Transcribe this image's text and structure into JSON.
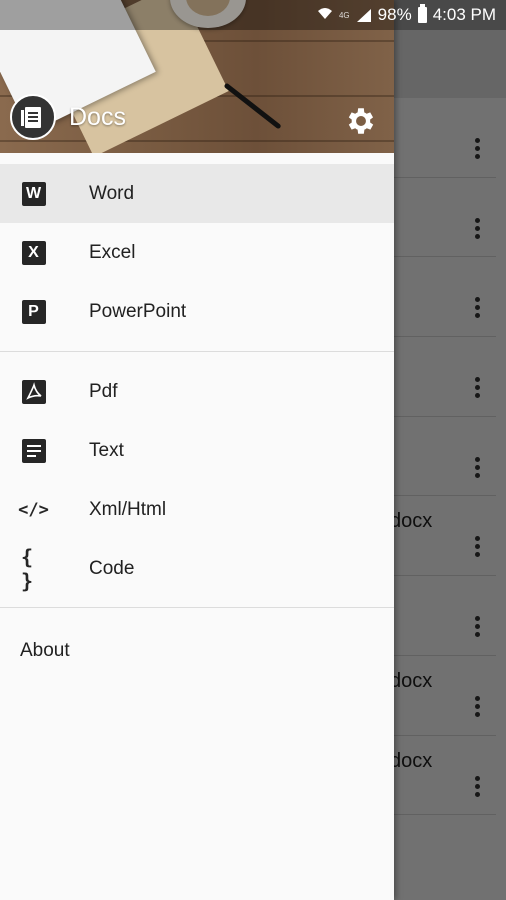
{
  "status_bar": {
    "battery": "98%",
    "time": "4:03 PM",
    "network": "4G"
  },
  "drawer": {
    "app_name": "Docs",
    "groups": [
      [
        {
          "label": "Word",
          "icon": "word-icon",
          "glyph": "W",
          "active": true
        },
        {
          "label": "Excel",
          "icon": "excel-icon",
          "glyph": "X",
          "active": false
        },
        {
          "label": "PowerPoint",
          "icon": "powerpoint-icon",
          "glyph": "P",
          "active": false
        }
      ],
      [
        {
          "label": "Pdf",
          "icon": "pdf-icon",
          "active": false
        },
        {
          "label": "Text",
          "icon": "text-icon",
          "active": false
        },
        {
          "label": "Xml/Html",
          "icon": "code-tag-icon",
          "glyph": "</>",
          "active": false
        },
        {
          "label": "Code",
          "icon": "braces-icon",
          "glyph": "{ }",
          "active": false
        }
      ]
    ],
    "about_label": "About"
  },
  "background_list": {
    "rows": [
      "",
      "",
      "",
      "",
      "",
      "docx",
      "",
      "docx",
      "docx",
      ""
    ]
  }
}
